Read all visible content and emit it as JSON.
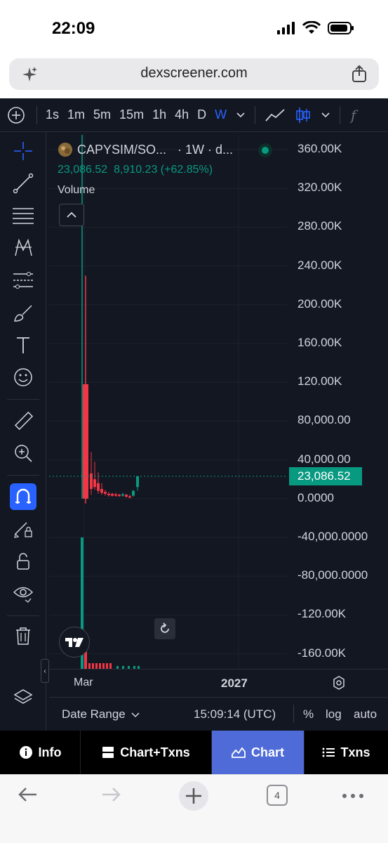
{
  "status_bar": {
    "time": "22:09"
  },
  "browser": {
    "url": "dexscreener.com",
    "tab_count": "4"
  },
  "toolbar": {
    "timeframes": [
      "1s",
      "1m",
      "5m",
      "15m",
      "1h",
      "4h",
      "D",
      "W"
    ],
    "active_timeframe": "W",
    "accent_color": "#2962ff"
  },
  "left_tools": {
    "icons": [
      "crosshair-icon",
      "trend-line-icon",
      "fib-retracement-icon",
      "pattern-icon",
      "prediction-icon",
      "brush-icon",
      "text-icon",
      "emoji-icon",
      "ruler-icon",
      "zoom-in-icon",
      "magnet-icon",
      "lock-drawing-icon",
      "unlock-icon",
      "eye-icon",
      "trash-icon",
      "layers-icon"
    ],
    "active": "magnet-icon"
  },
  "legend": {
    "symbol": "CAPYSIM/SO...",
    "interval": "· 1W · d...",
    "values": "23,086.52  8,910.23 (+62.85%)",
    "volume_label": "Volume"
  },
  "current_price": "23,086.52",
  "chart_data": {
    "type": "candlestick",
    "title": "",
    "price_axis_labels": [
      "360.00K",
      "320.00K",
      "280.00K",
      "240.00K",
      "200.00K",
      "160.00K",
      "120.00K",
      "80,000.00",
      "40,000.00",
      "0.0000",
      "-40,000.0000",
      "-80,000.0000",
      "-120.00K",
      "-160.00K"
    ],
    "time_axis_labels": [
      "Mar",
      "2027"
    ],
    "ylim": [
      -160000,
      360000
    ],
    "last_price": 23086.52,
    "up_color": "#089981",
    "down_color": "#f23645"
  },
  "bottom_strip": {
    "date_range": "Date Range",
    "time": "15:09:14 (UTC)",
    "percent": "%",
    "log": "log",
    "auto": "auto"
  },
  "bottom_nav": {
    "info": "Info",
    "chart_txns": "Chart+Txns",
    "chart": "Chart",
    "txns": "Txns"
  }
}
